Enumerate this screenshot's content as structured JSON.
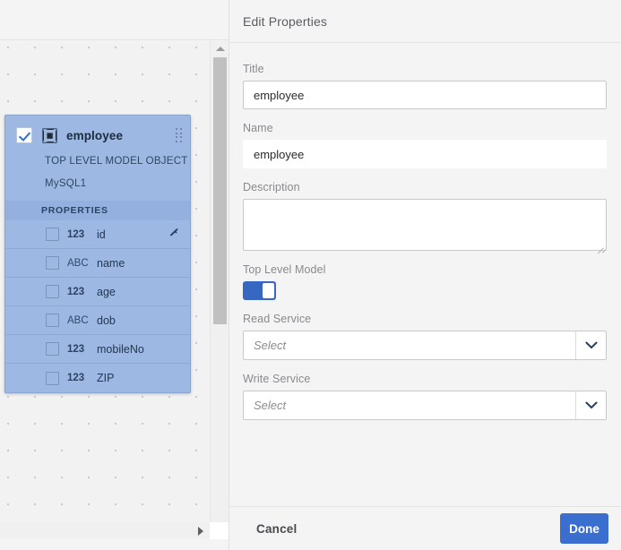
{
  "canvas": {
    "card": {
      "checkbox_checked": true,
      "icon": "model-object-icon",
      "title": "employee",
      "subtitle_1": "TOP LEVEL MODEL OBJECT",
      "subtitle_2": "MySQL1",
      "properties_header": "PROPERTIES",
      "drag_handle": "drag-handle-icon",
      "properties": [
        {
          "type": "123",
          "name": "id",
          "is_key": true
        },
        {
          "type": "ABC",
          "name": "name",
          "is_key": false
        },
        {
          "type": "123",
          "name": "age",
          "is_key": false
        },
        {
          "type": "ABC",
          "name": "dob",
          "is_key": false
        },
        {
          "type": "123",
          "name": "mobileNo",
          "is_key": false
        },
        {
          "type": "123",
          "name": "ZIP",
          "is_key": false
        }
      ]
    },
    "scrollbar": {
      "up_arrow": "scroll-up-icon",
      "down_arrow": "scroll-down-icon",
      "right_arrow": "scroll-right-icon"
    }
  },
  "panel": {
    "header": {
      "title": "Edit Properties"
    },
    "fields": {
      "title": {
        "label": "Title",
        "value": "employee"
      },
      "name": {
        "label": "Name",
        "value": "employee"
      },
      "description": {
        "label": "Description",
        "value": ""
      },
      "top_level_model": {
        "label": "Top Level Model",
        "enabled": true
      },
      "read_service": {
        "label": "Read Service",
        "placeholder": "Select",
        "value": "Select"
      },
      "write_service": {
        "label": "Write Service",
        "placeholder": "Select",
        "value": "Select"
      }
    },
    "footer": {
      "cancel_label": "Cancel",
      "done_label": "Done"
    }
  },
  "colors": {
    "accent_blue": "#3a6fd0",
    "toggle_on": "#3767c0",
    "card_fill": "#9db8e3",
    "card_header_band": "#93b0df",
    "panel_bg": "#f4f4f4",
    "canvas_bg": "#f2f2f2"
  }
}
